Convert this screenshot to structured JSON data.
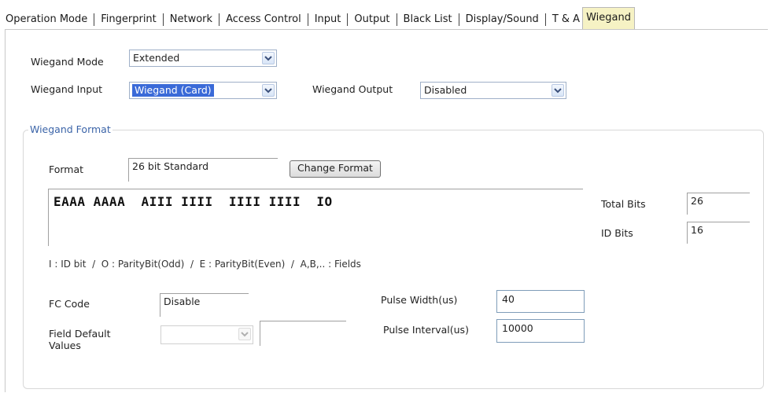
{
  "tabs": [
    {
      "label": "Operation Mode",
      "active": false
    },
    {
      "label": "Fingerprint",
      "active": false
    },
    {
      "label": "Network",
      "active": false
    },
    {
      "label": "Access Control",
      "active": false
    },
    {
      "label": "Input",
      "active": false
    },
    {
      "label": "Output",
      "active": false
    },
    {
      "label": "Black List",
      "active": false
    },
    {
      "label": "Display/Sound",
      "active": false
    },
    {
      "label": "T & A",
      "active": false
    },
    {
      "label": "Wiegand",
      "active": true
    }
  ],
  "wiegand_mode": {
    "label": "Wiegand Mode",
    "value": "Extended"
  },
  "wiegand_input": {
    "label": "Wiegand Input",
    "value": "Wiegand (Card)"
  },
  "wiegand_output": {
    "label": "Wiegand Output",
    "value": "Disabled"
  },
  "format_group": {
    "title": "Wiegand Format",
    "format_label": "Format",
    "format_value": "26 bit Standard",
    "change_format_button": "Change Format",
    "bit_pattern": "EAAA AAAA  AIII IIII  IIII IIII  IO",
    "total_bits_label": "Total Bits",
    "total_bits_value": "26",
    "id_bits_label": "ID Bits",
    "id_bits_value": "16",
    "legend": "I : ID bit  /  O : ParityBit(Odd)  /  E : ParityBit(Even)  /  A,B,.. : Fields",
    "fc_code_label": "FC Code",
    "fc_code_value": "Disable",
    "field_default_label": "Field Default Values",
    "field_default_select": "",
    "field_default_value": "",
    "pulse_width_label": "Pulse Width(us)",
    "pulse_width_value": "40",
    "pulse_interval_label": "Pulse Interval(us)",
    "pulse_interval_value": "10000"
  },
  "colors": {
    "active_tab_bg": "#f6f2c4",
    "group_title": "#3b64a8",
    "selection": "#3a6ad8"
  },
  "icons": {
    "dropdown": "chevron-down-icon"
  }
}
